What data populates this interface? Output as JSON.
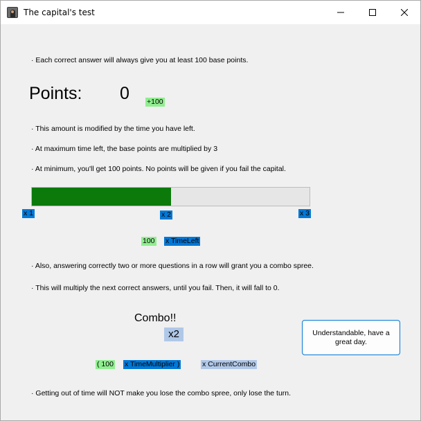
{
  "window": {
    "title": "The capital's test",
    "icon": "portrait-icon",
    "controls": [
      "minimize-icon",
      "maximize-icon",
      "close-icon"
    ]
  },
  "content": {
    "line1": "· Each correct answer will always give you at least 100 base points.",
    "points_label": "Points:",
    "points_value": "0",
    "points_bonus": "+100",
    "line2": "· This amount is modified by the time you have left.",
    "line3": "· At maximum time left, the base points are multiplied by 3",
    "line4": "· At minimum, you'll get 100 points. No points will be given if you fail the capital.",
    "time_progress": 0.5,
    "multiplier_min": "x 1",
    "multiplier_mid": "x 2",
    "multiplier_max": "x 3",
    "formula_base": "100",
    "formula_time": "x TimeLeft",
    "line5": "· Also, answering correctly two or more questions in a row will grant you a combo spree.",
    "line6": "· This will multiply the next correct answers, until you fail. Then, it will fall to 0.",
    "combo_title": "Combo!!",
    "combo_multiplier": "x2",
    "combo_formula_base": "( 100",
    "combo_formula_time": "x TimeMultiplier )",
    "combo_formula_combo": "x CurrentCombo",
    "line7": "· Getting out of time will NOT make you lose the combo spree, only lose the turn.",
    "ok_button": "Understandable, have a great day."
  },
  "colors": {
    "green_highlight": "#90ee90",
    "blue_highlight": "#0078d7",
    "light_blue_highlight": "#b0c8e8",
    "progress_fill": "#0b7a0b"
  }
}
